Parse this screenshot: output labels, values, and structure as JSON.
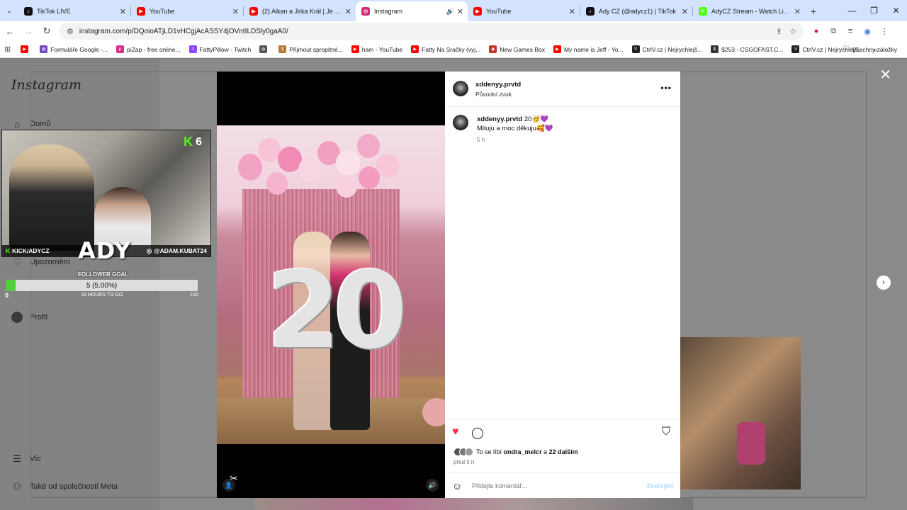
{
  "tabs": [
    {
      "title": "TikTok LIVE",
      "icon": "tiktok-icon",
      "color": "#111111",
      "active": false
    },
    {
      "title": "YouTube",
      "icon": "youtube-icon",
      "color": "#ff0000",
      "active": false
    },
    {
      "title": "(2) Alkan a Jirka Král | Je nejlep",
      "icon": "youtube-icon",
      "color": "#ff0000",
      "active": false
    },
    {
      "title": "Instagram",
      "icon": "instagram-icon",
      "color": "#d62976",
      "active": true
    },
    {
      "title": "YouTube",
      "icon": "youtube-icon",
      "color": "#ff0000",
      "active": false
    },
    {
      "title": "Ady CZ (@adycz1) | TikTok",
      "icon": "tiktok-icon",
      "color": "#111111",
      "active": false
    },
    {
      "title": "AdyCZ Stream - Watch Live on",
      "icon": "kick-icon",
      "color": "#53fc18",
      "active": false
    }
  ],
  "url": "instagram.com/p/DQoioATjLD1vHCgjAcASSY4jOVntILDSly0gaA0/",
  "bookmarks": [
    {
      "label": "",
      "icon": "youtube-icon",
      "color": "#ff0000"
    },
    {
      "label": "Formuláře Google -...",
      "icon": "forms-icon",
      "color": "#7248b9"
    },
    {
      "label": "piZap - free online...",
      "icon": "pizap-icon",
      "color": "#d4328a"
    },
    {
      "label": "FattyPillow - Twitch",
      "icon": "twitch-icon",
      "color": "#9146ff"
    },
    {
      "label": "",
      "icon": "globe-icon",
      "color": "#555555"
    },
    {
      "label": "Přijmout spropitné...",
      "icon": "tip-icon",
      "color": "#b07a3a"
    },
    {
      "label": "ham - YouTube",
      "icon": "youtube-icon",
      "color": "#ff0000"
    },
    {
      "label": "Fatty Na Sračky (vyj...",
      "icon": "youtube-icon",
      "color": "#ff0000"
    },
    {
      "label": "New Games Box",
      "icon": "games-icon",
      "color": "#c0392b"
    },
    {
      "label": "My name is Jeff - Yo...",
      "icon": "youtube-icon",
      "color": "#ff0000"
    },
    {
      "label": "CtrlV.cz | Nejrychlejš...",
      "icon": "ctrlv-icon",
      "color": "#222222"
    },
    {
      "label": "$253 - CSGOFAST.C...",
      "icon": "csgofast-icon",
      "color": "#333333"
    },
    {
      "label": "CtrlV.cz | Nejrychlejš...",
      "icon": "ctrlv-icon",
      "color": "#222222"
    }
  ],
  "bookmarks_all": "Všechny záložky",
  "instagram": {
    "logo": "Instagram",
    "nav": {
      "home": "Domů",
      "notifications": "Upozornění",
      "profile": "Profil",
      "more": "Víc",
      "meta": "Také od společnosti Meta"
    }
  },
  "post": {
    "username": "xddenyy.prvtd",
    "audio": "Původní zvuk",
    "caption_user": "xddenyy.prvtd",
    "caption_text1": "20🥳💜",
    "caption_text2": "Miluju a moc děkuju🥰💜",
    "caption_time": "5 h",
    "likes_prefix": "To se líbí",
    "likes_user": "ondra_melcr",
    "likes_and": "a",
    "likes_others": "22 dalším",
    "posted_ago": "před 5 h",
    "comment_placeholder": "Přidejte komentář...",
    "post_button": "Zveřejnit",
    "photo_number": "20"
  },
  "stream": {
    "kick_count": "6",
    "kick_handle": "KICK/ADYCZ",
    "insta_handle": "@ADAM.KUBAT24",
    "logo": "ADY",
    "goal_label": "FOLLOWER GOAL",
    "goal_text": "5 (5.00%)",
    "goal_progress": 0.05,
    "goal_min": "0",
    "goal_max": "100",
    "goal_time": "18 HOURS TO GO"
  },
  "colors": {
    "accent_like": "#ff3040",
    "tabstrip": "#d3e3fd",
    "kick_green": "#53fc18"
  }
}
